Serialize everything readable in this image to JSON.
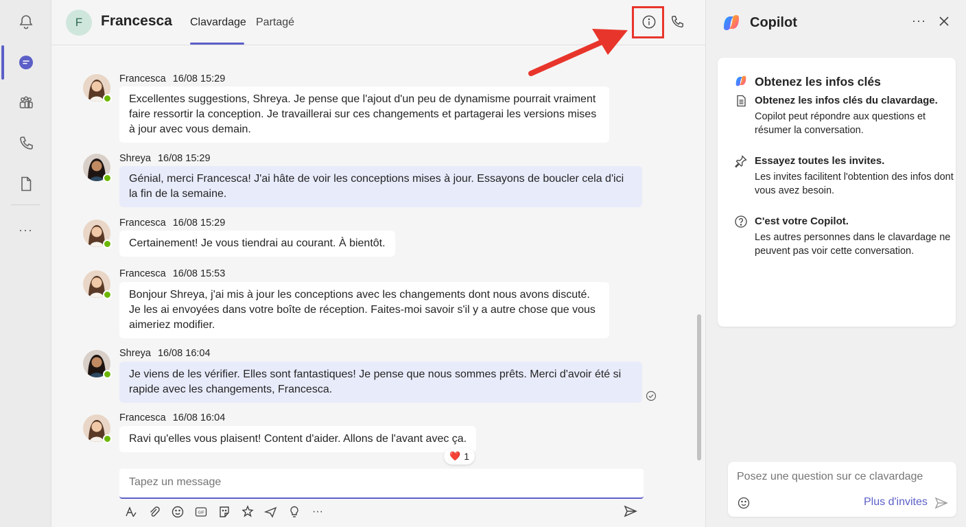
{
  "rail": {
    "items": [
      {
        "name": "activity",
        "icon": "bell-icon"
      },
      {
        "name": "chat",
        "icon": "chat-icon",
        "active": true
      },
      {
        "name": "teams",
        "icon": "teams-icon"
      },
      {
        "name": "calls",
        "icon": "phone-icon"
      },
      {
        "name": "files",
        "icon": "file-icon"
      }
    ],
    "more_label": "···"
  },
  "header": {
    "initial": "F",
    "name": "Francesca",
    "tabs": [
      {
        "label": "Clavardage",
        "active": true
      },
      {
        "label": "Partagé",
        "active": false
      }
    ]
  },
  "messages": [
    {
      "author": "Francesca",
      "time": "16/08 15:29",
      "self": false,
      "text": "Excellentes suggestions, Shreya. Je pense que l'ajout d'un peu de dynamisme pourrait vraiment faire ressortir la conception. Je travaillerai sur ces changements et partagerai les versions mises à jour avec vous demain."
    },
    {
      "author": "Shreya",
      "time": "16/08 15:29",
      "self": true,
      "text": "Génial, merci Francesca! J'ai hâte de voir les conceptions mises à jour. Essayons de boucler cela d'ici la fin de la semaine."
    },
    {
      "author": "Francesca",
      "time": "16/08 15:29",
      "self": false,
      "text": "Certainement! Je vous tiendrai au courant. À bientôt."
    },
    {
      "author": "Francesca",
      "time": "16/08 15:53",
      "self": false,
      "text": "Bonjour Shreya, j'ai mis à jour les conceptions avec les changements dont nous avons discuté. Je les ai envoyées dans votre boîte de réception. Faites-moi savoir s'il y a autre chose que vous aimeriez modifier."
    },
    {
      "author": "Shreya",
      "time": "16/08 16:04",
      "self": true,
      "text": "Je viens de les vérifier. Elles sont fantastiques! Je pense que nous sommes prêts. Merci d'avoir été si rapide avec les changements, Francesca."
    },
    {
      "author": "Francesca",
      "time": "16/08 16:04",
      "self": false,
      "text": "Ravi qu'elles vous plaisent! Content d'aider. Allons de l'avant avec ça."
    }
  ],
  "reaction": {
    "emoji": "❤️",
    "count": "1"
  },
  "compose": {
    "placeholder": "Tapez un message"
  },
  "copilot": {
    "title": "Copilot",
    "card_title": "Obtenez les infos clés",
    "items": [
      {
        "icon": "document-icon",
        "title": "Obtenez les infos clés du clavardage.",
        "desc": "Copilot peut répondre aux questions et résumer la conversation."
      },
      {
        "icon": "pin-icon",
        "title": "Essayez toutes les invites.",
        "desc": "Les invites facilitent l'obtention des infos dont vous avez besoin."
      },
      {
        "icon": "question-icon",
        "title": "C'est votre Copilot.",
        "desc": "Les autres personnes dans le clavardage ne peuvent pas voir cette conversation."
      }
    ],
    "input_placeholder": "Posez une question sur ce clavardage",
    "prompts_label": "Plus d'invites"
  },
  "colors": {
    "accent": "#5b5fc7",
    "highlight": "#e8352b",
    "presence": "#6bb700",
    "self_bubble": "#e8ebfa"
  }
}
